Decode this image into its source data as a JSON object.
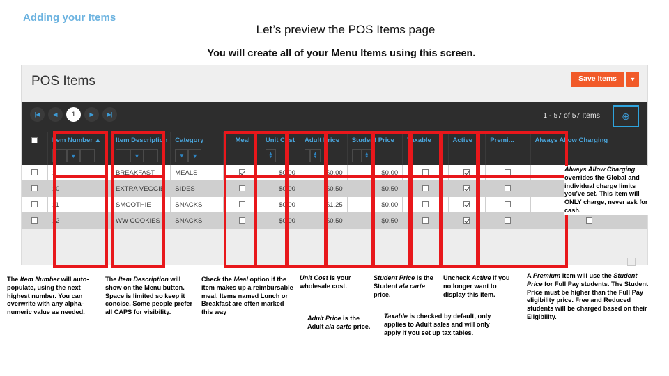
{
  "slide": {
    "kicker": "Adding your Items",
    "title": "Let’s preview the POS Items page",
    "subtitle": "You will create all of your Menu Items using this screen."
  },
  "app": {
    "title": "POS Items",
    "save_label": "Save Items",
    "save_menu_glyph": "▾",
    "record_count": "1 - 57 of 57 Items",
    "add_item_glyph": "⊕",
    "pager": [
      {
        "name": "first",
        "glyph": "|◀",
        "active": false
      },
      {
        "name": "prev",
        "glyph": "◀",
        "active": false
      },
      {
        "name": "page-1",
        "glyph": "1",
        "active": true
      },
      {
        "name": "next",
        "glyph": "▶",
        "active": false
      },
      {
        "name": "last",
        "glyph": "▶|",
        "active": false
      }
    ],
    "filter_icon": "▼",
    "dropdown_icon": "▾",
    "spin_up": "▲",
    "spin_down": "▼",
    "columns": [
      {
        "key": "select",
        "label": "",
        "filter": "none"
      },
      {
        "key": "item_number",
        "label": "Item Number ▲",
        "filter": "text"
      },
      {
        "key": "item_description",
        "label": "Item Description",
        "filter": "text"
      },
      {
        "key": "category",
        "label": "Category",
        "filter": "select"
      },
      {
        "key": "meal",
        "label": "Meal",
        "filter": "none"
      },
      {
        "key": "unit_cost",
        "label": "Unit Cost",
        "filter": "spin"
      },
      {
        "key": "adult_price",
        "label": "Adult Price",
        "filter": "spin2"
      },
      {
        "key": "student_price",
        "label": "Student Price",
        "filter": "spin2"
      },
      {
        "key": "taxable",
        "label": "Taxable",
        "filter": "none"
      },
      {
        "key": "active",
        "label": "Active",
        "filter": "none"
      },
      {
        "key": "premium",
        "label": "Premi...",
        "filter": "none"
      },
      {
        "key": "always_allow_charging",
        "label": "Always Allow Charging",
        "filter": "none"
      }
    ],
    "rows": [
      {
        "select": false,
        "item_number": "1",
        "item_description": "BREAKFAST",
        "category": "MEALS",
        "meal": true,
        "unit_cost": "$0.00",
        "adult_price": "$0.00",
        "student_price": "$0.00",
        "taxable": false,
        "active": true,
        "premium": false,
        "always_allow_charging": false
      },
      {
        "select": false,
        "item_number": "10",
        "item_description": "EXTRA VEGGIE",
        "category": "SIDES",
        "meal": false,
        "unit_cost": "$0.00",
        "adult_price": "$0.50",
        "student_price": "$0.50",
        "taxable": false,
        "active": true,
        "premium": false,
        "always_allow_charging": false
      },
      {
        "select": false,
        "item_number": "11",
        "item_description": "SMOOTHIE",
        "category": "SNACKS",
        "meal": false,
        "unit_cost": "$0.00",
        "adult_price": "$1.25",
        "student_price": "$0.00",
        "taxable": false,
        "active": true,
        "premium": false,
        "always_allow_charging": false
      },
      {
        "select": false,
        "item_number": "12",
        "item_description": "WW COOKIES",
        "category": "SNACKS",
        "meal": false,
        "unit_cost": "$0.00",
        "adult_price": "$0.50",
        "student_price": "$0.50",
        "taxable": false,
        "active": true,
        "premium": false,
        "always_allow_charging": false
      }
    ]
  },
  "highlight_color": "#e8171b",
  "accent_color": "#f15a29",
  "link_color": "#4aa6dd",
  "notes": {
    "always_allow_charging": "Always Allow Charging overrides the Global and individual charge limits you’ve set. This item will ONLY charge, never ask for cash.",
    "item_number": "The Item Number will auto-populate, using the next highest number. You can overwrite with any alpha-numeric value as needed.",
    "item_description": "The Item Description will show on the Menu button. Space is limited so keep it concise. Some people prefer all CAPS for visibility.",
    "meal": "Check the Meal option if the item makes up a reimbursable meal. Items named Lunch or Breakfast are often marked this way",
    "unit_cost": "Unit Cost is your wholesale cost.",
    "adult_price": "Adult Price is the Adult ala carte price.",
    "student_price": "Student Price is the Student ala carte price.",
    "taxable": "Taxable is checked by default, only applies to Adult sales and will only apply if you set up tax tables.",
    "active": "Uncheck Active if you no longer want to display this item.",
    "premium": "A Premium item will use the Student Price for Full Pay students. The Student Price must be higher than the Full Pay eligibility price. Free and Reduced students will be charged based on their Eligibility."
  }
}
